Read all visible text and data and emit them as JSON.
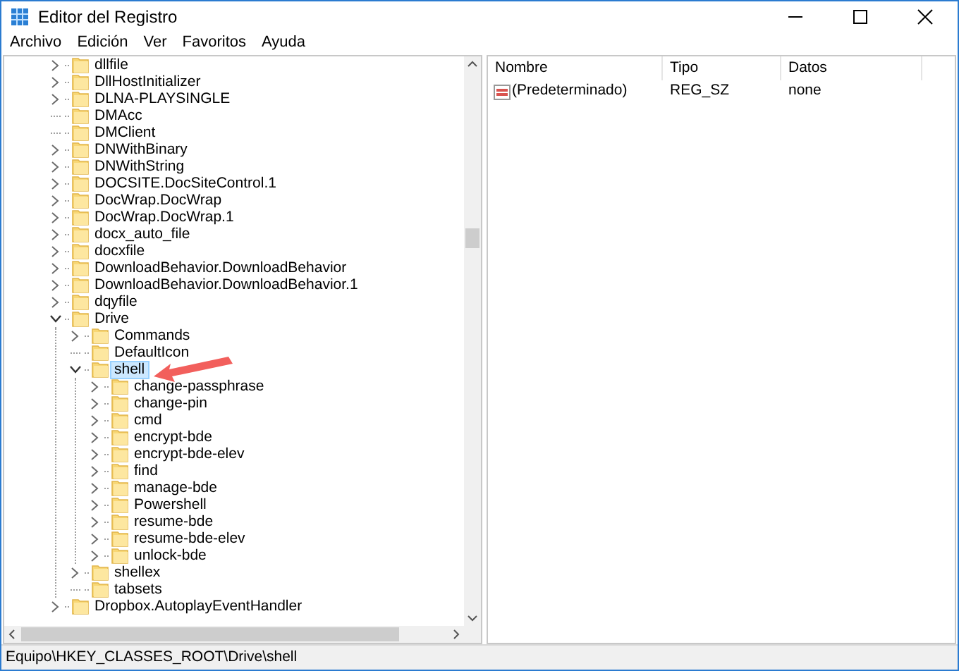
{
  "window": {
    "title": "Editor del Registro"
  },
  "menu": [
    "Archivo",
    "Edición",
    "Ver",
    "Favoritos",
    "Ayuda"
  ],
  "tree": [
    {
      "label": "dllfile",
      "kind": "branch",
      "expanded": false,
      "selected": false
    },
    {
      "label": "DllHostInitializer",
      "kind": "branch",
      "expanded": false,
      "selected": false
    },
    {
      "label": "DLNA-PLAYSINGLE",
      "kind": "branch",
      "expanded": false,
      "selected": false
    },
    {
      "label": "DMAcc",
      "kind": "leaf",
      "selected": false
    },
    {
      "label": "DMClient",
      "kind": "leaf",
      "selected": false
    },
    {
      "label": "DNWithBinary",
      "kind": "branch",
      "expanded": false,
      "selected": false
    },
    {
      "label": "DNWithString",
      "kind": "branch",
      "expanded": false,
      "selected": false
    },
    {
      "label": "DOCSITE.DocSiteControl.1",
      "kind": "branch",
      "expanded": false,
      "selected": false
    },
    {
      "label": "DocWrap.DocWrap",
      "kind": "branch",
      "expanded": false,
      "selected": false
    },
    {
      "label": "DocWrap.DocWrap.1",
      "kind": "branch",
      "expanded": false,
      "selected": false
    },
    {
      "label": "docx_auto_file",
      "kind": "branch",
      "expanded": false,
      "selected": false
    },
    {
      "label": "docxfile",
      "kind": "branch",
      "expanded": false,
      "selected": false
    },
    {
      "label": "DownloadBehavior.DownloadBehavior",
      "kind": "branch",
      "expanded": false,
      "selected": false
    },
    {
      "label": "DownloadBehavior.DownloadBehavior.1",
      "kind": "branch",
      "expanded": false,
      "selected": false
    },
    {
      "label": "dqyfile",
      "kind": "branch",
      "expanded": false,
      "selected": false
    },
    {
      "label": "Drive",
      "kind": "branch",
      "expanded": true,
      "selected": false,
      "children": [
        {
          "label": "Commands",
          "kind": "branch",
          "expanded": false,
          "selected": false
        },
        {
          "label": "DefaultIcon",
          "kind": "leaf",
          "selected": false
        },
        {
          "label": "shell",
          "kind": "branch",
          "expanded": true,
          "selected": true,
          "children": [
            {
              "label": "change-passphrase",
              "kind": "branch",
              "expanded": false,
              "selected": false
            },
            {
              "label": "change-pin",
              "kind": "branch",
              "expanded": false,
              "selected": false
            },
            {
              "label": "cmd",
              "kind": "branch",
              "expanded": false,
              "selected": false
            },
            {
              "label": "encrypt-bde",
              "kind": "branch",
              "expanded": false,
              "selected": false
            },
            {
              "label": "encrypt-bde-elev",
              "kind": "branch",
              "expanded": false,
              "selected": false
            },
            {
              "label": "find",
              "kind": "branch",
              "expanded": false,
              "selected": false
            },
            {
              "label": "manage-bde",
              "kind": "branch",
              "expanded": false,
              "selected": false
            },
            {
              "label": "Powershell",
              "kind": "branch",
              "expanded": false,
              "selected": false
            },
            {
              "label": "resume-bde",
              "kind": "branch",
              "expanded": false,
              "selected": false
            },
            {
              "label": "resume-bde-elev",
              "kind": "branch",
              "expanded": false,
              "selected": false
            },
            {
              "label": "unlock-bde",
              "kind": "branch",
              "expanded": false,
              "selected": false
            }
          ]
        },
        {
          "label": "shellex",
          "kind": "branch",
          "expanded": false,
          "selected": false
        },
        {
          "label": "tabsets",
          "kind": "leaf",
          "selected": false
        }
      ]
    },
    {
      "label": "Dropbox.AutoplayEventHandler",
      "kind": "branch",
      "expanded": false,
      "selected": false
    }
  ],
  "values": {
    "columns": [
      "Nombre",
      "Tipo",
      "Datos"
    ],
    "rows": [
      {
        "name": "(Predeterminado)",
        "type": "REG_SZ",
        "data": "none"
      }
    ]
  },
  "status_bar": "Equipo\\HKEY_CLASSES_ROOT\\Drive\\shell"
}
